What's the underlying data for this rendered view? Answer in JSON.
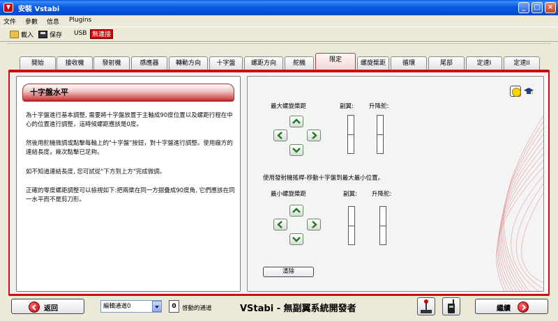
{
  "window": {
    "title": "安裝 Vstabi"
  },
  "menu": [
    "文件",
    "參數",
    "信息",
    "Plugins"
  ],
  "toolbar": {
    "load": "載入",
    "save": "保存",
    "usb": "USB",
    "connection": "無連接"
  },
  "tabs": [
    {
      "label": "開始",
      "active": false
    },
    {
      "label": "接收機",
      "active": false
    },
    {
      "label": "發射機",
      "active": false
    },
    {
      "label": "感應器",
      "active": false
    },
    {
      "label": "轉動方向",
      "active": false
    },
    {
      "label": "十字盤",
      "active": false
    },
    {
      "label": "螺距方向",
      "active": false
    },
    {
      "label": "舵機",
      "active": false
    },
    {
      "label": "限定",
      "active": true
    },
    {
      "label": "螺旋槳距",
      "active": false
    },
    {
      "label": "循環",
      "active": false
    },
    {
      "label": "尾部",
      "active": false
    },
    {
      "label": "定速I",
      "active": false
    },
    {
      "label": "定速II",
      "active": false
    }
  ],
  "left_panel": {
    "title": "十字盤水平",
    "paragraphs": [
      "為十字盤進行基本調整, 需要將十字盤放置于主軸成90度位置以及螺距行程在中心的位置進行調整，這時候螺距應該是0度。",
      "然後用舵機微調或點擊每軸上的\"十字盤\"按鈕，對十字盤進行調整。使用廠方的連結長度，幾次點擊已足夠。",
      "如不知道連結長度, 您可試從\"下方到上方\"完成微調。",
      "正確的零度螺距調整可以檢視如下:把兩槳在同一方摺疊成90度角, 它們應該在同一水平而不是剪刀形。"
    ]
  },
  "right_panel": {
    "max_pitch": "最大螺旋槳距",
    "min_pitch": "最小螺旋槳距",
    "aileron": "副翼:",
    "collective": "升降舵:",
    "instruction": "使用發射機搖桿-移動十字盤到最大最小位置。",
    "clear": "清除"
  },
  "bottom": {
    "back": "返回",
    "channel_select": "編輯通道0",
    "count": "0",
    "active_channel": "啓動的通道",
    "brand": "VStabi - 無副翼系統開發者",
    "continue": "繼續"
  },
  "colors": {
    "frame": "#c81010",
    "title_bar": "#0a5ae0",
    "usb_status": "#d40000"
  }
}
